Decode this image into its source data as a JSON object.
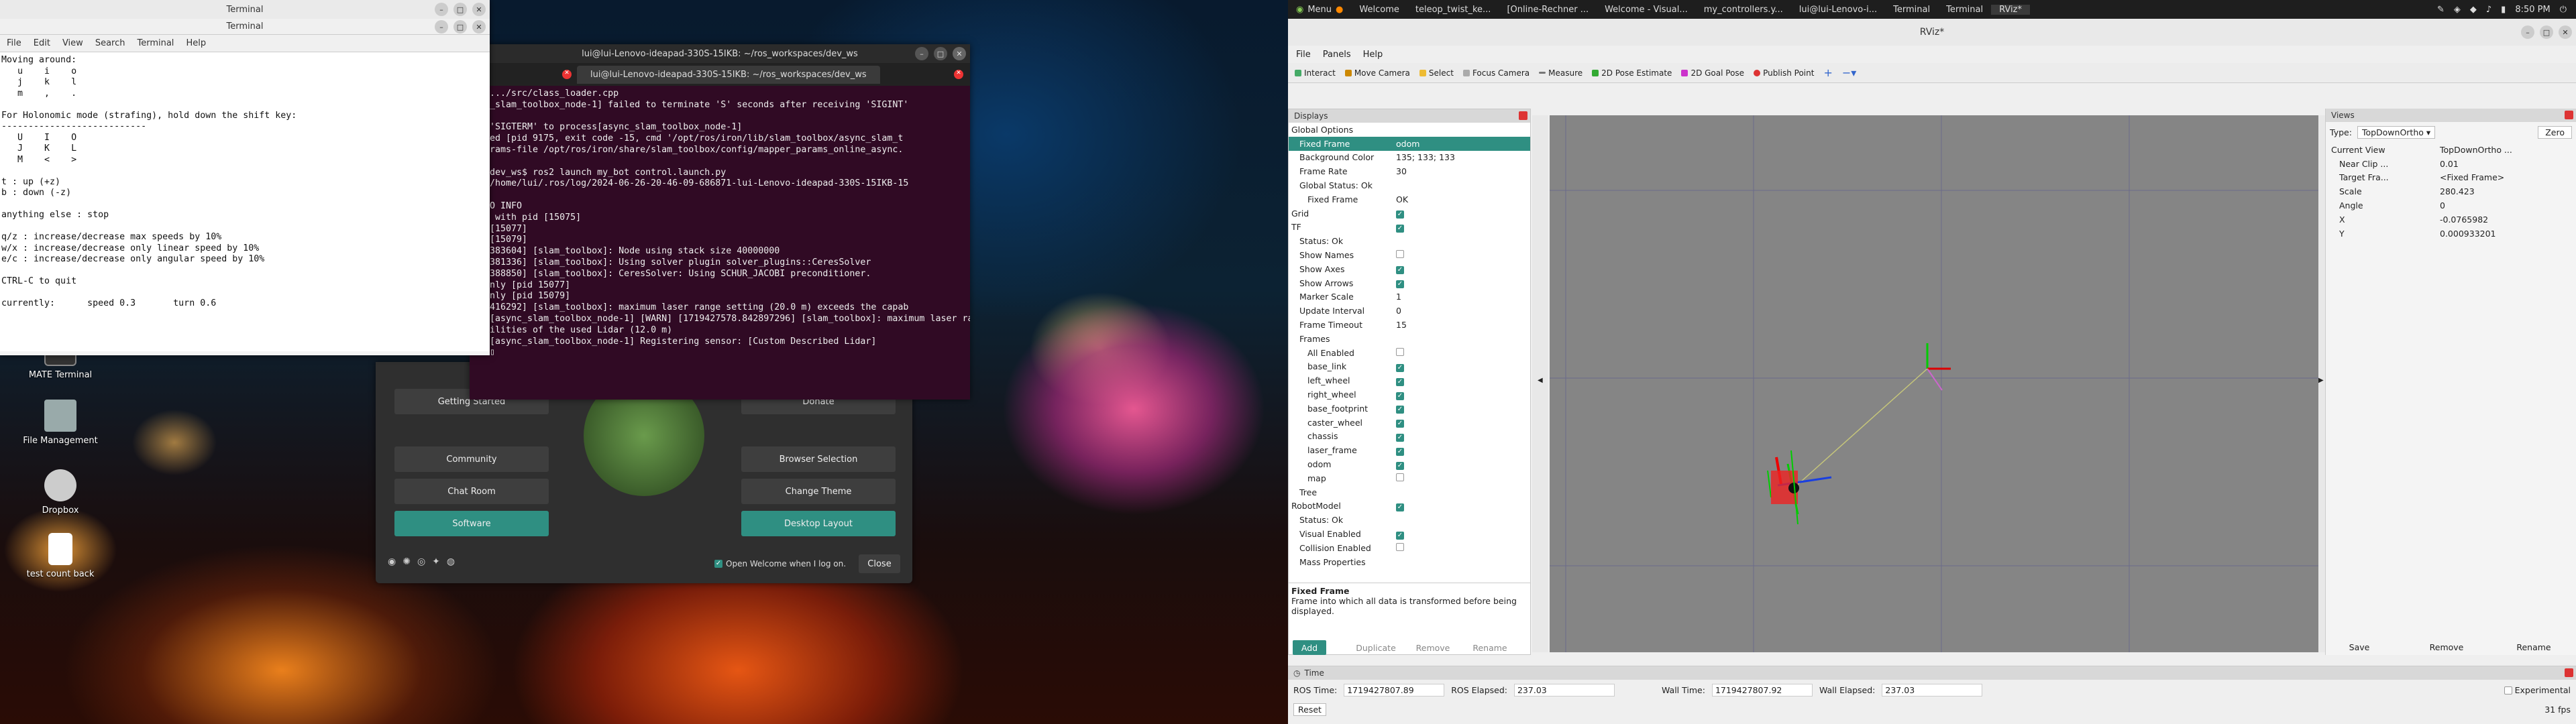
{
  "desktop_icons": [
    {
      "label": "MATE Terminal"
    },
    {
      "label": "File Management"
    },
    {
      "label": "Dropbox"
    },
    {
      "label": "test count back"
    }
  ],
  "term1": {
    "title": "Terminal",
    "tab_title": "Terminal",
    "menu": [
      "File",
      "Edit",
      "View",
      "Search",
      "Terminal",
      "Help"
    ],
    "text": "Moving around:\n   u    i    o\n   j    k    l\n   m    ,    .\n\nFor Holonomic mode (strafing), hold down the shift key:\n---------------------------\n   U    I    O\n   J    K    L\n   M    <    >\n\nt : up (+z)\nb : down (-z)\n\nanything else : stop\n\nq/z : increase/decrease max speeds by 10%\nw/x : increase/decrease only linear speed by 10%\ne/c : increase/decrease only angular speed by 10%\n\nCTRL-C to quit\n\ncurrently:      speed 0.3       turn 0.6\n"
  },
  "term2": {
    "title": "lui@lui-Lenovo-ideapad-330S-15IKB: ~/ros_workspaces/dev_ws",
    "tab": "lui@lui-Lenovo-ideapad-330S-15IKB: ~/ros_workspaces/dev_ws",
    "text": ".../src/class_loader.cpp\n_slam_toolbox_node-1] failed to terminate 'S' seconds after receiving 'SIGINT'\n\n'SIGTERM' to process[async_slam_toolbox_node-1]\ned [pid 9175, exit code -15, cmd '/opt/ros/iron/lib/slam_toolbox/async_slam_t\nrams-file /opt/ros/iron/share/slam_toolbox/config/mapper_params_online_async.\n\ndev_ws$ ros2 launch my_bot control.launch.py\n/home/lui/.ros/log/2024-06-26-20-46-09-686871-lui-Lenovo-ideapad-330S-15IKB-15\n\nO INFO\n with pid [15075]\n[15077]\n[15079]\n383604] [slam_toolbox]: Node using stack size 40000000\n381336] [slam_toolbox]: Using solver plugin solver_plugins::CeresSolver\n388850] [slam_toolbox]: CeresSolver: Using SCHUR_JACOBI preconditioner.\nnly [pid 15077]\nnly [pid 15079]\n416292] [slam_toolbox]: maximum laser range setting (20.0 m) exceeds the capab\n[async_slam_toolbox_node-1] [WARN] [1719427578.842897296] [slam_toolbox]: maximum laser range setting (20.0 m) exceeds the capab\nilities of the used Lidar (12.0 m)\n[async_slam_toolbox_node-1] Registering sensor: [Custom Described Lidar]\n▯"
  },
  "welcome": {
    "buttons": {
      "getting_started": "Getting Started",
      "donate": "Donate",
      "community": "Community",
      "browser": "Browser Selection",
      "chat": "Chat Room",
      "theme": "Change Theme",
      "software": "Software",
      "layout": "Desktop Layout"
    },
    "open_label": "Open Welcome when I log on.",
    "close": "Close"
  },
  "topbar": {
    "menu": "Menu",
    "tasks": [
      "Welcome",
      "teleop_twist_ke...",
      "[Online-Rechner ...",
      "Welcome - Visual...",
      "my_controllers.y...",
      "lui@lui-Lenovo-i...",
      "Terminal",
      "Terminal",
      "RViz*"
    ],
    "clock": "8:50 PM"
  },
  "rviz": {
    "title": "RViz*",
    "menu": [
      "File",
      "Panels",
      "Help"
    ],
    "tools": [
      "Interact",
      "Move Camera",
      "Select",
      "Focus Camera",
      "Measure",
      "2D Pose Estimate",
      "2D Goal Pose",
      "Publish Point"
    ],
    "displays_title": "Displays",
    "displays": [
      {
        "k": "Global Options",
        "v": "",
        "d": 0
      },
      {
        "k": "Fixed Frame",
        "v": "odom",
        "d": 1,
        "sel": true
      },
      {
        "k": "Background Color",
        "v": "135; 133; 133",
        "d": 1
      },
      {
        "k": "Frame Rate",
        "v": "30",
        "d": 1
      },
      {
        "k": "Global Status: Ok",
        "v": "",
        "d": 1
      },
      {
        "k": "Fixed Frame",
        "v": "OK",
        "d": 2
      },
      {
        "k": "Grid",
        "v": "",
        "d": 0,
        "c": 1
      },
      {
        "k": "TF",
        "v": "",
        "d": 0,
        "c": 1
      },
      {
        "k": "Status: Ok",
        "v": "",
        "d": 1
      },
      {
        "k": "Show Names",
        "v": "",
        "d": 1,
        "c": 0
      },
      {
        "k": "Show Axes",
        "v": "",
        "d": 1,
        "c": 1
      },
      {
        "k": "Show Arrows",
        "v": "",
        "d": 1,
        "c": 1
      },
      {
        "k": "Marker Scale",
        "v": "1",
        "d": 1
      },
      {
        "k": "Update Interval",
        "v": "0",
        "d": 1
      },
      {
        "k": "Frame Timeout",
        "v": "15",
        "d": 1
      },
      {
        "k": "Frames",
        "v": "",
        "d": 1
      },
      {
        "k": "All Enabled",
        "v": "",
        "d": 2,
        "c": 0
      },
      {
        "k": "base_link",
        "v": "",
        "d": 2,
        "c": 1
      },
      {
        "k": "left_wheel",
        "v": "",
        "d": 2,
        "c": 1
      },
      {
        "k": "right_wheel",
        "v": "",
        "d": 2,
        "c": 1
      },
      {
        "k": "base_footprint",
        "v": "",
        "d": 2,
        "c": 1
      },
      {
        "k": "caster_wheel",
        "v": "",
        "d": 2,
        "c": 1
      },
      {
        "k": "chassis",
        "v": "",
        "d": 2,
        "c": 1
      },
      {
        "k": "laser_frame",
        "v": "",
        "d": 2,
        "c": 1
      },
      {
        "k": "odom",
        "v": "",
        "d": 2,
        "c": 1
      },
      {
        "k": "map",
        "v": "",
        "d": 2,
        "c": 0
      },
      {
        "k": "Tree",
        "v": "",
        "d": 1
      },
      {
        "k": "RobotModel",
        "v": "",
        "d": 0,
        "c": 1
      },
      {
        "k": "Status: Ok",
        "v": "",
        "d": 1
      },
      {
        "k": "Visual Enabled",
        "v": "",
        "d": 1,
        "c": 1
      },
      {
        "k": "Collision Enabled",
        "v": "",
        "d": 1,
        "c": 0
      },
      {
        "k": "Mass Properties",
        "v": "",
        "d": 1
      }
    ],
    "desc_title": "Fixed Frame",
    "desc_text": "Frame into which all data is transformed before being displayed.",
    "display_buttons": [
      "Add",
      "Duplicate",
      "Remove",
      "Rename"
    ],
    "views_title": "Views",
    "type_label": "Type:",
    "type_value": "TopDownOrtho",
    "zero": "Zero",
    "views": [
      {
        "k": "Current View",
        "v": "TopDownOrtho ..."
      },
      {
        "k": "Near Clip ...",
        "v": "0.01"
      },
      {
        "k": "Target Fra...",
        "v": "<Fixed Frame>"
      },
      {
        "k": "Scale",
        "v": "280.423"
      },
      {
        "k": "Angle",
        "v": "0"
      },
      {
        "k": "X",
        "v": "-0.0765982"
      },
      {
        "k": "Y",
        "v": "0.000933201"
      }
    ],
    "view_buttons": [
      "Save",
      "Remove",
      "Rename"
    ],
    "time_title": "Time",
    "time": {
      "ros_time_label": "ROS Time:",
      "ros_time": "1719427807.89",
      "ros_elapsed_label": "ROS Elapsed:",
      "ros_elapsed": "237.03",
      "wall_time_label": "Wall Time:",
      "wall_time": "1719427807.92",
      "wall_elapsed_label": "Wall Elapsed:",
      "wall_elapsed": "237.03",
      "experimental": "Experimental",
      "reset": "Reset",
      "fps": "31 fps"
    }
  }
}
